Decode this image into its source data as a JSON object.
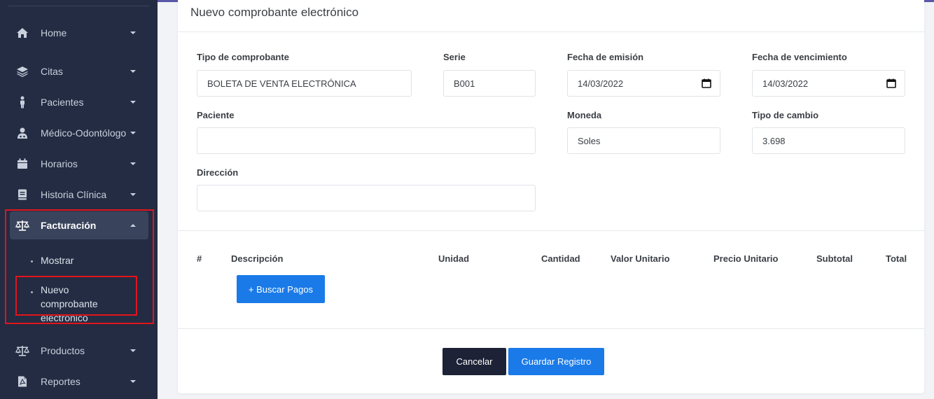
{
  "sidebar": {
    "items": [
      {
        "label": "Home",
        "icon": "home-icon"
      },
      {
        "label": "Citas",
        "icon": "layers-icon"
      },
      {
        "label": "Pacientes",
        "icon": "person-icon"
      },
      {
        "label": "Médico-Odontólogo",
        "icon": "doctor-icon"
      },
      {
        "label": "Horarios",
        "icon": "calendar-icon"
      },
      {
        "label": "Historia Clínica",
        "icon": "book-icon"
      },
      {
        "label": "Facturación",
        "icon": "balance-scale-icon"
      },
      {
        "label": "Productos",
        "icon": "balance-scale-icon"
      },
      {
        "label": "Reportes",
        "icon": "pdf-file-icon"
      }
    ],
    "facturacion_sub": [
      {
        "label": "Mostrar"
      },
      {
        "label": "Nuevo comprobante electrónico"
      }
    ]
  },
  "card": {
    "title": "Nuevo comprobante electrónico"
  },
  "form": {
    "tipo_comprobante": {
      "label": "Tipo de comprobante",
      "value": "BOLETA DE VENTA ELECTRÓNICA"
    },
    "serie": {
      "label": "Serie",
      "value": "B001"
    },
    "fecha_emision": {
      "label": "Fecha de emisión",
      "value": "14/03/2022"
    },
    "fecha_vencimiento": {
      "label": "Fecha de vencimiento",
      "value": "14/03/2022"
    },
    "paciente": {
      "label": "Paciente",
      "value": ""
    },
    "moneda": {
      "label": "Moneda",
      "value": "Soles"
    },
    "tipo_cambio": {
      "label": "Tipo de cambio",
      "value": "3.698"
    },
    "direccion": {
      "label": "Dirección",
      "value": ""
    }
  },
  "table": {
    "headers": [
      "#",
      "Descripción",
      "Unidad",
      "Cantidad",
      "Valor Unitario",
      "Precio Unitario",
      "Subtotal",
      "Total"
    ],
    "search_button": "+ Buscar Pagos"
  },
  "actions": {
    "cancel": "Cancelar",
    "save": "Guardar Registro"
  },
  "colors": {
    "sidebar_bg": "#232c43",
    "accent_blue": "#1a7ae8",
    "dark_button": "#1d2236",
    "highlight_red": "#e3141b"
  }
}
